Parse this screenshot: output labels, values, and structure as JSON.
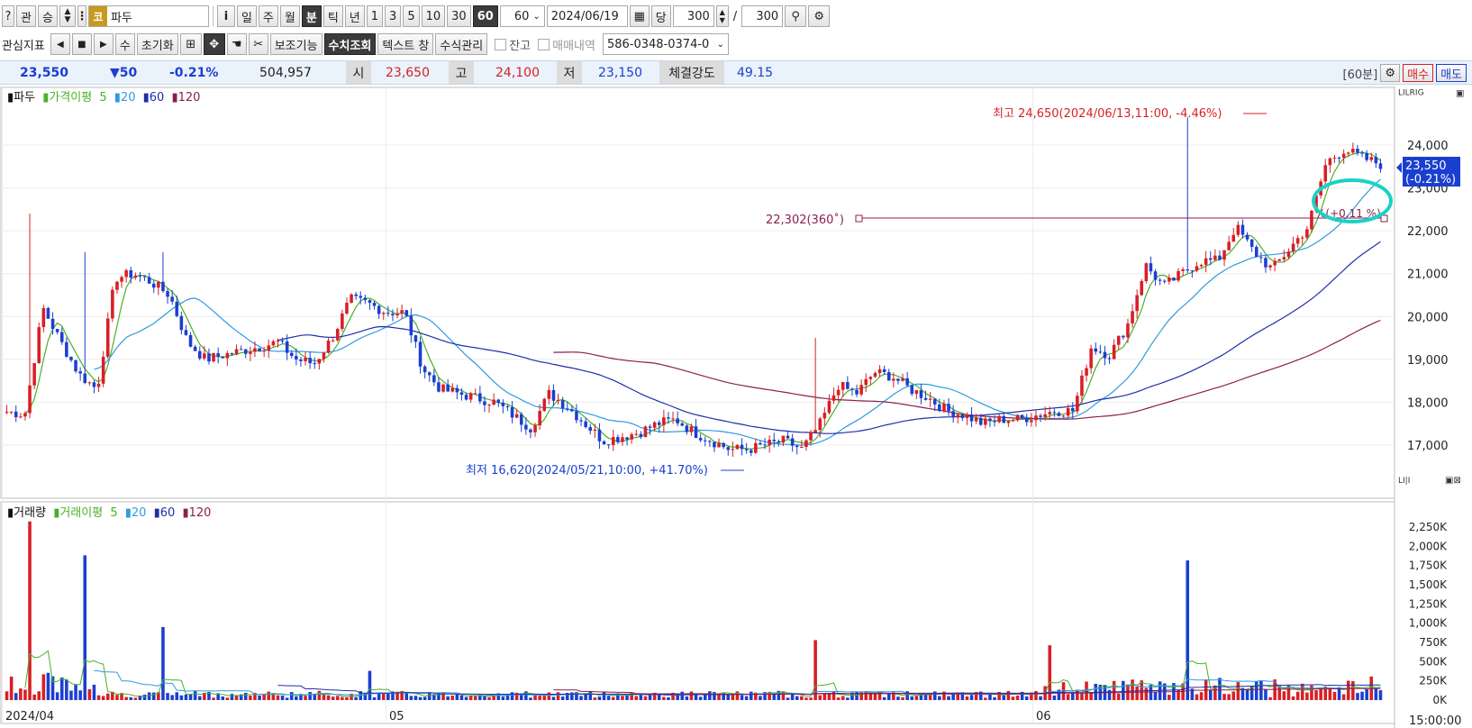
{
  "toolbar1": {
    "btn_q": "?",
    "btn_gwan": "관",
    "btn_seung": "승",
    "code_badge": "코",
    "stock_name": "파두",
    "periods": [
      "i",
      "일",
      "주",
      "월",
      "분",
      "틱",
      "년"
    ],
    "minutes": [
      "1",
      "3",
      "5",
      "10",
      "30",
      "60"
    ],
    "interval_value": "60",
    "date": "2024/06/19",
    "dang": "당",
    "count": "300",
    "slash": "/",
    "total": "300"
  },
  "toolbar2": {
    "interest": "관심지표",
    "su": "수",
    "reset": "초기화",
    "aux": "보조기능",
    "num_query": "수치조회",
    "text_window": "텍스트 창",
    "formula": "수식관리",
    "jango": "잔고",
    "trade_history": "매매내역",
    "account": "586-0348-0374-0"
  },
  "quote": {
    "price": "23,550",
    "change": "▼50",
    "change_pct": "-0.21%",
    "volume": "504,957",
    "open_label": "시",
    "open": "23,650",
    "high_label": "고",
    "high": "24,100",
    "low_label": "저",
    "low": "23,150",
    "strength_label": "체결강도",
    "strength": "49.15",
    "period_badge": "[60분]",
    "buy": "매수",
    "sell": "매도"
  },
  "chart_data": [
    {
      "type": "candlestick",
      "title": "파두",
      "ma_label": "가격이평",
      "legend": [
        {
          "name": "5",
          "color": "#4caf2a"
        },
        {
          "name": "20",
          "color": "#2e9be0"
        },
        {
          "name": "60",
          "color": "#1f2ea8"
        },
        {
          "name": "120",
          "color": "#8a1f4f"
        }
      ],
      "y_ticks": [
        "24,000",
        "23,000",
        "22,000",
        "21,000",
        "20,000",
        "19,000",
        "18,000",
        "17,000"
      ],
      "y_range": [
        16600,
        24900
      ],
      "x_ticks": [
        "2024/04",
        "05",
        "06"
      ],
      "current_price_label": "23,550",
      "current_change_label": "(-0.21%)",
      "high_annotation": "최고 24,650(2024/06/13,11:00, -4.46%)",
      "low_annotation": "최저 16,620(2024/05/21,10:00, +41.70%)",
      "line_annotation": "22,302(360˚)",
      "line_tail": "%(+0.11 %)",
      "close_path": [
        17780,
        17720,
        20200,
        19400,
        18650,
        18300,
        20900,
        21000,
        20800,
        20500,
        19400,
        19000,
        19100,
        19200,
        19300,
        19400,
        19000,
        18900,
        19500,
        20400,
        20300,
        20100,
        20100,
        18800,
        18300,
        18200,
        18100,
        18000,
        17700,
        17400,
        18200,
        17900,
        17500,
        17100,
        17200,
        17300,
        17500,
        17600,
        17300,
        17100,
        16900,
        16900,
        17000,
        17100,
        16900,
        17500,
        18400,
        18200,
        18700,
        18600,
        18300,
        18100,
        17800,
        17700,
        17500,
        17600,
        17600,
        17700,
        17800,
        17800,
        19300,
        19100,
        19800,
        21200,
        20700,
        21000,
        21300,
        21300,
        22100,
        21500,
        21100,
        21600,
        22100,
        23600,
        23900,
        23700,
        23550
      ],
      "volume": {
        "title": "거래량",
        "ma_label": "거래이평",
        "y_ticks": [
          "2,250K",
          "2,000K",
          "1,750K",
          "1,500K",
          "1,250K",
          "1,000K",
          "750K",
          "500K",
          "250K",
          "0K"
        ],
        "last_time": "15:00:00"
      }
    }
  ]
}
